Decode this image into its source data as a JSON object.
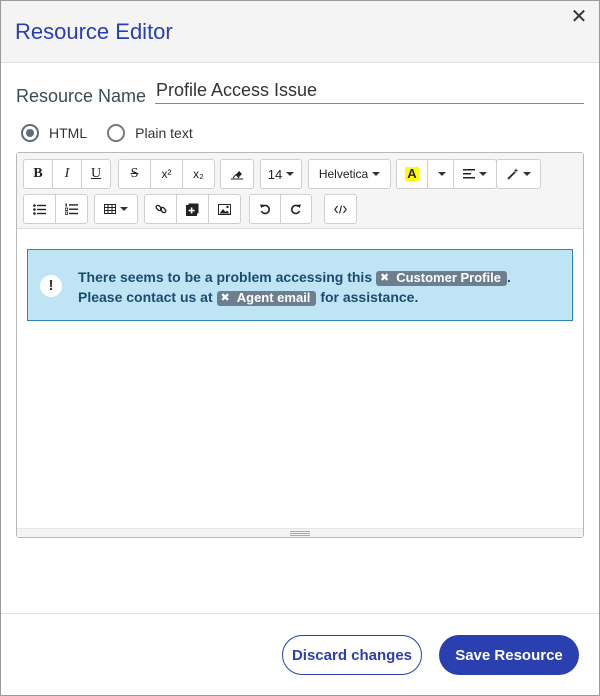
{
  "dialog": {
    "title": "Resource Editor",
    "close_glyph": "✕"
  },
  "form": {
    "name_label": "Resource Name",
    "name_value": "Profile Access Issue",
    "format_options": [
      {
        "label": "HTML",
        "checked": true
      },
      {
        "label": "Plain text",
        "checked": false
      }
    ]
  },
  "toolbar": {
    "bold": "B",
    "italic": "I",
    "underline": "U",
    "strikethrough": "S",
    "superscript": "x²",
    "subscript": "x₂",
    "font_size": "14",
    "font_family": "Helvetica",
    "color_letter": "A"
  },
  "editor": {
    "alert_line1_before": "There seems to be a problem accessing this",
    "chip_customer": "Customer Profile",
    "alert_line1_after": ".",
    "alert_line2_before": "Please contact us at",
    "chip_agent": "Agent email",
    "alert_line2_after": "for assistance.",
    "alert_icon_glyph": "!"
  },
  "footer": {
    "discard_label": "Discard changes",
    "save_label": "Save Resource"
  },
  "colors": {
    "accent": "#2a3fb0",
    "alert_bg": "#bfe5f5",
    "alert_border": "#2f83b6",
    "chip_bg": "#6d7e8e",
    "highlight_yellow": "#ffff00"
  }
}
